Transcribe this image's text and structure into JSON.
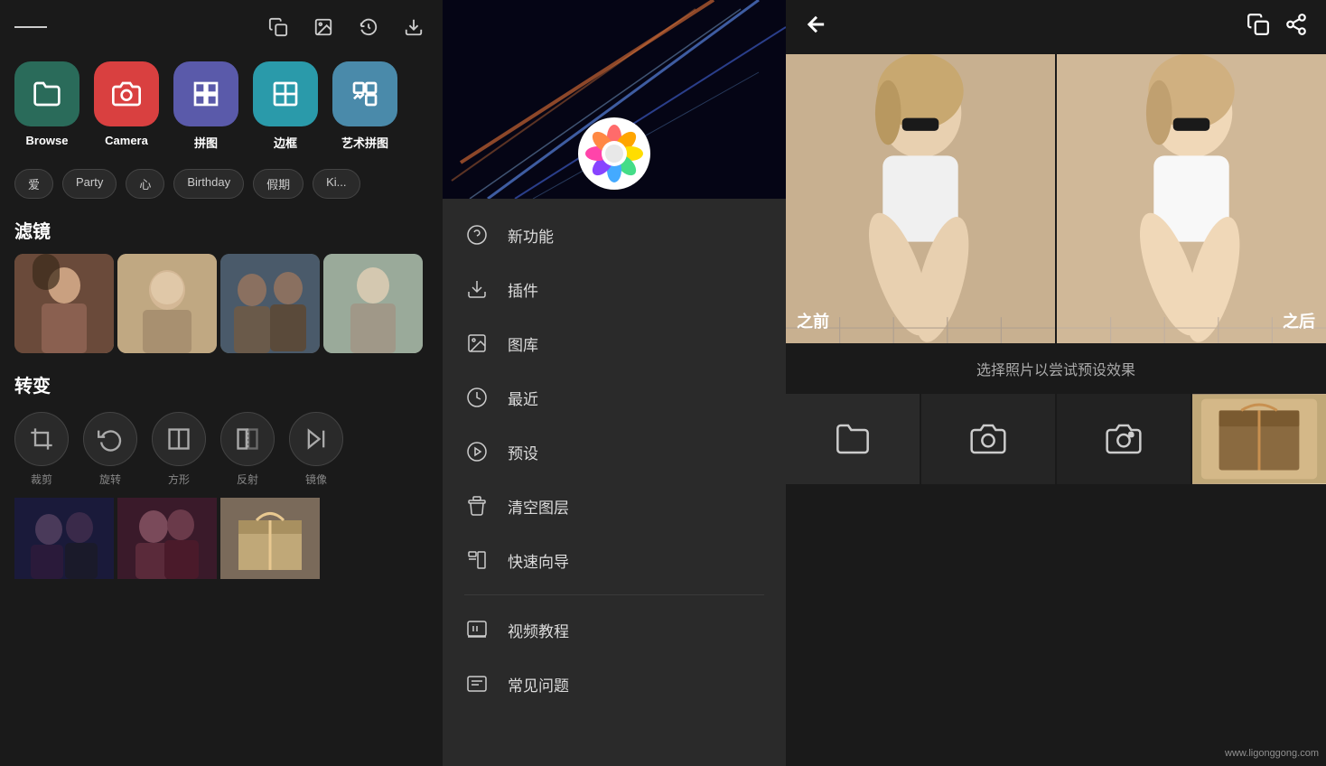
{
  "leftPanel": {
    "toolbar": {
      "hamburgerLabel": "menu",
      "icons": [
        "copy-icon",
        "image-icon",
        "history-icon",
        "download-icon"
      ]
    },
    "features": [
      {
        "id": "browse",
        "label": "Browse",
        "icon": "📁",
        "colorClass": "browse"
      },
      {
        "id": "camera",
        "label": "Camera",
        "icon": "📷",
        "colorClass": "camera"
      },
      {
        "id": "puzzle",
        "label": "拼图",
        "icon": "⊞",
        "colorClass": "puzzle"
      },
      {
        "id": "frame",
        "label": "边框",
        "icon": "▦",
        "colorClass": "frame"
      },
      {
        "id": "art",
        "label": "艺术拼图",
        "icon": "🖼",
        "colorClass": "art"
      }
    ],
    "tags": [
      "爱",
      "Party",
      "心",
      "Birthday",
      "假期",
      "Ki..."
    ],
    "sections": {
      "filters": {
        "title": "滤镜",
        "photos": [
          "girl1",
          "girl2",
          "group",
          "girl3"
        ]
      },
      "transform": {
        "title": "转变",
        "items": [
          {
            "label": "裁剪",
            "icon": "⊡"
          },
          {
            "label": "旋转",
            "icon": "↺"
          },
          {
            "label": "方形",
            "icon": "⊟"
          },
          {
            "label": "反射",
            "icon": "⊠"
          },
          {
            "label": "镜像",
            "icon": "▷|"
          }
        ]
      },
      "bottomPhotos": [
        "couple",
        "couple2",
        "gift"
      ]
    }
  },
  "middlePanel": {
    "heroAlt": "colorful light streaks",
    "menuItems": [
      {
        "id": "new-features",
        "icon": "❓",
        "label": "新功能"
      },
      {
        "id": "plugins",
        "icon": "⬇",
        "label": "插件"
      },
      {
        "id": "gallery",
        "icon": "🖼",
        "label": "图库"
      },
      {
        "id": "recent",
        "icon": "⏱",
        "label": "最近"
      },
      {
        "id": "presets",
        "icon": "▶",
        "label": "预设"
      },
      {
        "id": "clear-layers",
        "icon": "⊡",
        "label": "清空图层"
      },
      {
        "id": "quick-guide",
        "icon": "⊡",
        "label": "快速向导"
      },
      {
        "id": "video-tutorial",
        "icon": "📋",
        "label": "视频教程"
      },
      {
        "id": "faq",
        "icon": "🖨",
        "label": "常见问题"
      }
    ]
  },
  "rightPanel": {
    "toolbar": {
      "backLabel": "←",
      "icons": [
        "copy-icon",
        "share-icon"
      ]
    },
    "beforeAfter": {
      "beforeLabel": "之前",
      "afterLabel": "之后"
    },
    "previewText": "选择照片以尝试预设效果",
    "actionButtons": [
      "browse-icon",
      "camera-icon",
      "camera-settings-icon"
    ],
    "watermark": "www.ligonggong.com"
  }
}
